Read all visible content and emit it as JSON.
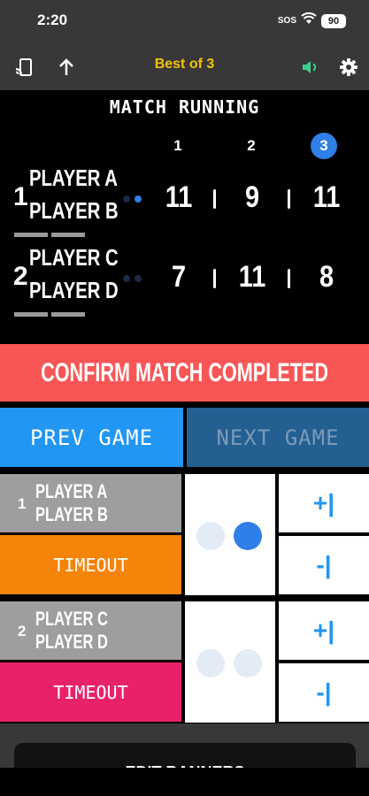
{
  "status_bar": {
    "time": "2:20",
    "sos": "SOS",
    "battery": "90"
  },
  "toolbar": {
    "title": "Best of 3",
    "icons": [
      "cast-icon",
      "arrow-up-icon",
      "speaker-icon",
      "gear-icon"
    ],
    "speaker_color": "#3ecf8e"
  },
  "scoreboard": {
    "status": "MATCH RUNNING",
    "games": [
      "1",
      "2",
      "3"
    ],
    "current_game": "3",
    "teams": [
      {
        "number": "1",
        "players": [
          "PLAYER A",
          "PLAYER B"
        ],
        "scores": [
          "11",
          "9",
          "11"
        ],
        "serving": true
      },
      {
        "number": "2",
        "players": [
          "PLAYER C",
          "PLAYER D"
        ],
        "scores": [
          "7",
          "11",
          "8"
        ],
        "serving": false
      }
    ]
  },
  "actions": {
    "confirm_label": "CONFIRM MATCH COMPLETED",
    "prev_label": "PREV GAME",
    "next_label": "NEXT GAME"
  },
  "controls": [
    {
      "number": "1",
      "players": [
        "PLAYER A",
        "PLAYER B"
      ],
      "timeout_label": "TIMEOUT",
      "timeout_color": "#f5840b",
      "plus_label": "+|",
      "minus_label": "-|"
    },
    {
      "number": "2",
      "players": [
        "PLAYER C",
        "PLAYER D"
      ],
      "timeout_label": "TIMEOUT",
      "timeout_color": "#e8226a",
      "plus_label": "+|",
      "minus_label": "-|"
    }
  ],
  "footer": {
    "edit_label": "EDIT BANNERS"
  },
  "colors": {
    "accent": "#2196f3",
    "confirm": "#f85656",
    "title": "#f4c20d"
  }
}
